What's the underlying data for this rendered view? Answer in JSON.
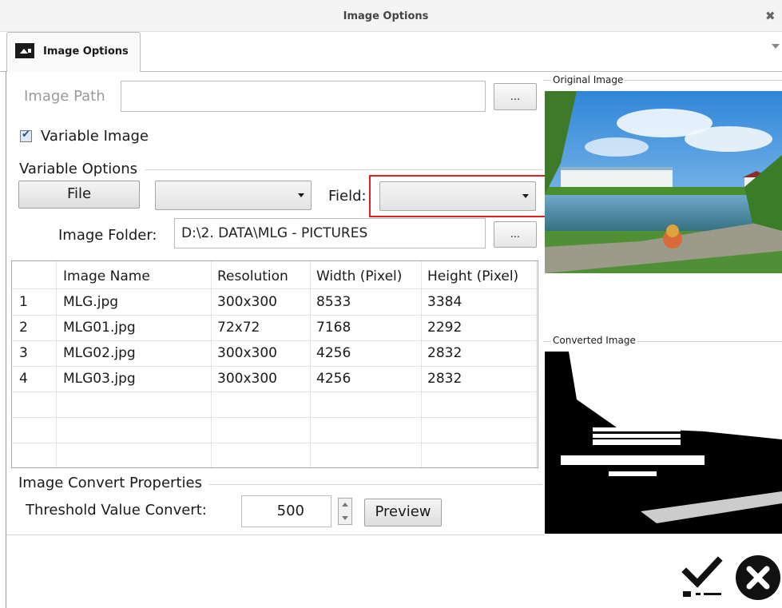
{
  "window": {
    "title": "Image Options"
  },
  "tab": {
    "label": "Image Options"
  },
  "image_path": {
    "label": "Image Path",
    "value": "",
    "browse_label": "..."
  },
  "variable_image": {
    "label": "Variable Image",
    "checked": true
  },
  "variable_options": {
    "title": "Variable Options",
    "file_button": "File",
    "file_combo_value": "",
    "field_label": "Field:",
    "field_combo_value": "",
    "image_folder_label": "Image Folder:",
    "image_folder_value": "D:\\2. DATA\\MLG - PICTURES",
    "image_folder_browse": "..."
  },
  "grid": {
    "columns": [
      "",
      "Image Name",
      "Resolution",
      "Width (Pixel)",
      "Height (Pixel)"
    ],
    "rows": [
      [
        "1",
        "MLG.jpg",
        "300x300",
        "8533",
        "3384"
      ],
      [
        "2",
        "MLG01.jpg",
        "72x72",
        "7168",
        "2292"
      ],
      [
        "3",
        "MLG02.jpg",
        "300x300",
        "4256",
        "2832"
      ],
      [
        "4",
        "MLG03.jpg",
        "300x300",
        "4256",
        "2832"
      ]
    ]
  },
  "convert": {
    "title": "Image Convert Properties",
    "threshold_label": "Threshold Value Convert:",
    "threshold_value": "500",
    "preview_button": "Preview"
  },
  "original_image": {
    "label": "Original Image"
  },
  "converted_image": {
    "label": "Converted Image"
  },
  "colors": {
    "highlight_border": "#e0201f",
    "sky": "#4a9be0",
    "grass": "#3f8d2a"
  }
}
